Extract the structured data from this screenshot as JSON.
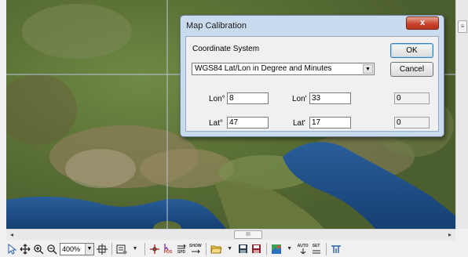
{
  "dialog": {
    "title": "Map Calibration",
    "close_label": "x",
    "coordinate_system_label": "Coordinate System",
    "coordinate_system_value": "WGS84 Lat/Lon in Degree and Minutes",
    "ok_label": "OK",
    "cancel_label": "Cancel",
    "lon_deg_label": "Lon°",
    "lon_deg_value": "8",
    "lon_min_label": "Lon'",
    "lon_min_value": "33",
    "lon_sec_value": "0",
    "lat_deg_label": "Lat°",
    "lat_deg_value": "47",
    "lat_min_label": "Lat'",
    "lat_min_value": "17",
    "lat_sec_value": "0"
  },
  "toolbar": {
    "zoom_value": "400%",
    "pos_label": "POS",
    "spd_label": "SPD",
    "show_label": "SHOW",
    "auto_label": "AUTO",
    "set_label": "SET"
  },
  "scrollbar": {
    "h_thumb_label": "III",
    "v_thumb_label": "≡"
  },
  "colors": {
    "dialog_frame": "#c9dbee",
    "close_button": "#c8452f",
    "sea": "#1f4f86",
    "land_green": "#5f7a3a",
    "land_brown": "#8a7a55"
  }
}
